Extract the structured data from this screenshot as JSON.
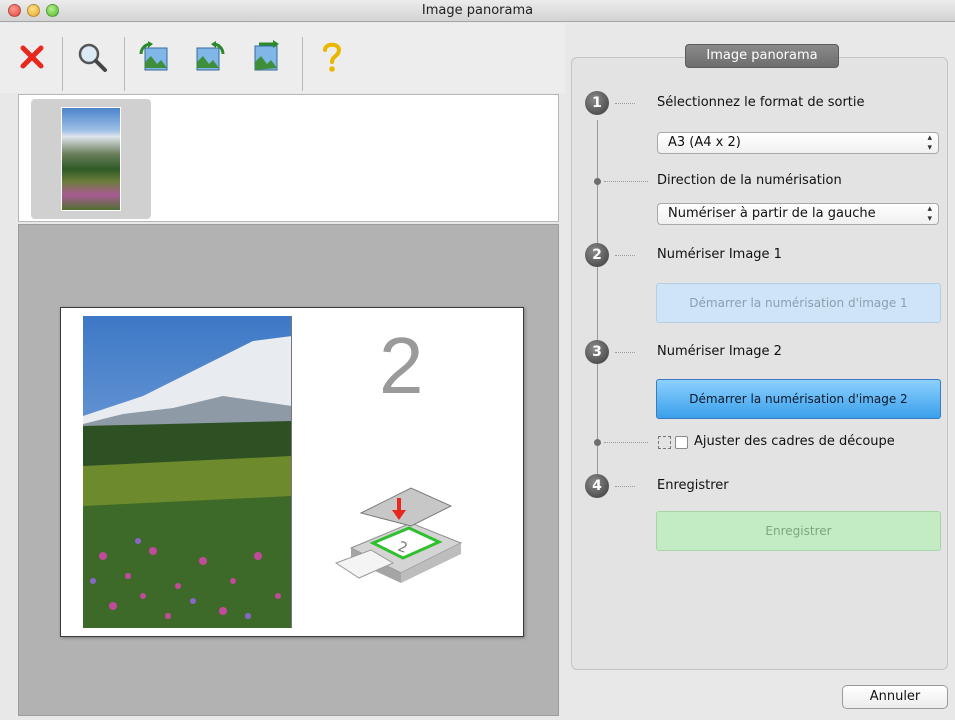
{
  "window": {
    "title": "Image panorama"
  },
  "toolbar": {
    "items": [
      {
        "icon": "delete-icon"
      },
      {
        "icon": "zoom-icon"
      },
      {
        "icon": "rotate-left-icon"
      },
      {
        "icon": "rotate-right-icon"
      },
      {
        "icon": "swap-image-icon"
      },
      {
        "icon": "help-icon"
      }
    ]
  },
  "preview": {
    "slot_number": "2"
  },
  "panel": {
    "tab_title": "Image panorama",
    "step1": {
      "number": "1",
      "label": "Sélectionnez le format de sortie",
      "format_value": "A3 (A4 x 2)",
      "direction_label": "Direction de la numérisation",
      "direction_value": "Numériser à partir de la gauche"
    },
    "step2": {
      "number": "2",
      "label": "Numériser Image 1",
      "button": "Démarrer la numérisation d'image 1"
    },
    "step3": {
      "number": "3",
      "label": "Numériser Image 2",
      "button": "Démarrer la numérisation d'image 2",
      "crop_label": "Ajuster des cadres de découpe"
    },
    "step4": {
      "number": "4",
      "label": "Enregistrer",
      "button": "Enregistrer"
    }
  },
  "footer": {
    "cancel": "Annuler"
  },
  "colors": {
    "accent_blue": "#3aa0ea",
    "delete_red": "#e8281e",
    "save_green": "#c4ecc4"
  }
}
